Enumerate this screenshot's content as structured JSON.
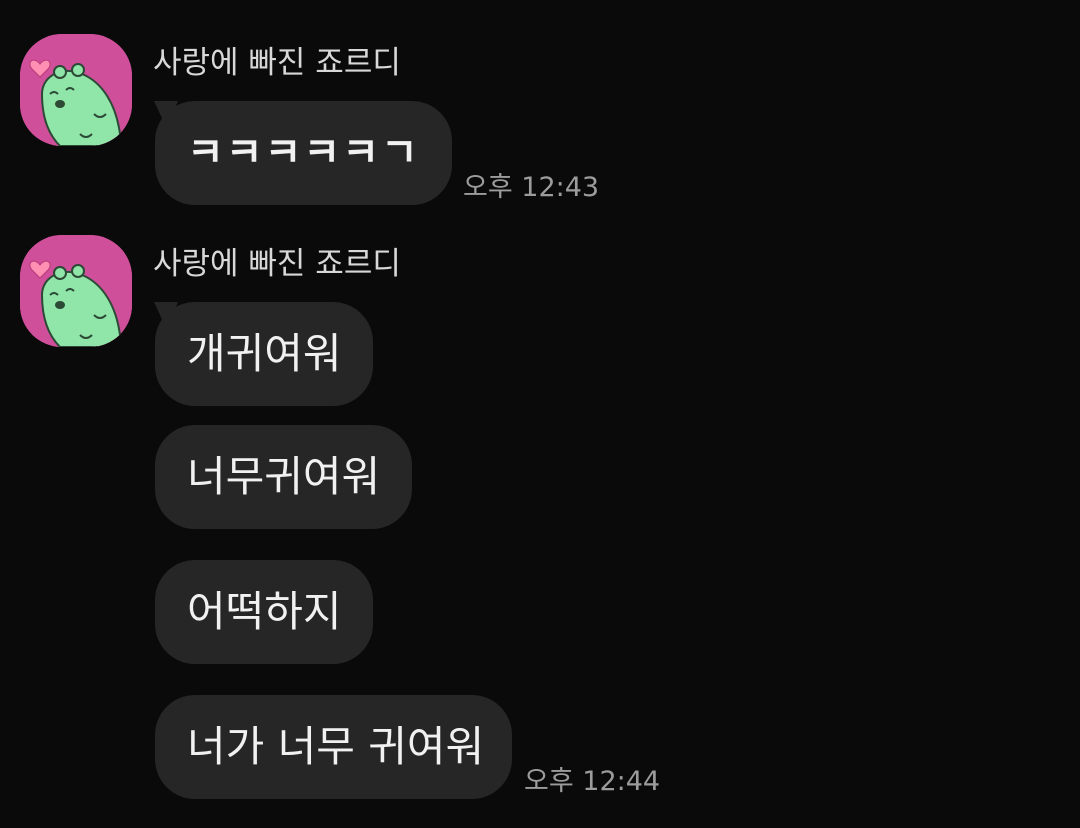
{
  "messages": [
    {
      "sender": "사랑에 빠진 죠르디",
      "avatar_icon": "jordy-in-love-avatar-icon",
      "bubbles": [
        "ㅋㅋㅋㅋㅋㄱ"
      ],
      "time": "오후 12:43"
    },
    {
      "sender": "사랑에 빠진 죠르디",
      "avatar_icon": "jordy-in-love-avatar-icon",
      "bubbles": [
        "개귀여워",
        "너무귀여워",
        "어떡하지",
        "너가 너무 귀여워"
      ],
      "time": "오후 12:44"
    }
  ],
  "colors": {
    "background": "#0a0a0a",
    "bubble": "#262626",
    "avatar_bg": "#cf4f9a",
    "jordy_green": "#8fe6a8",
    "heart": "#ff8fb3"
  }
}
